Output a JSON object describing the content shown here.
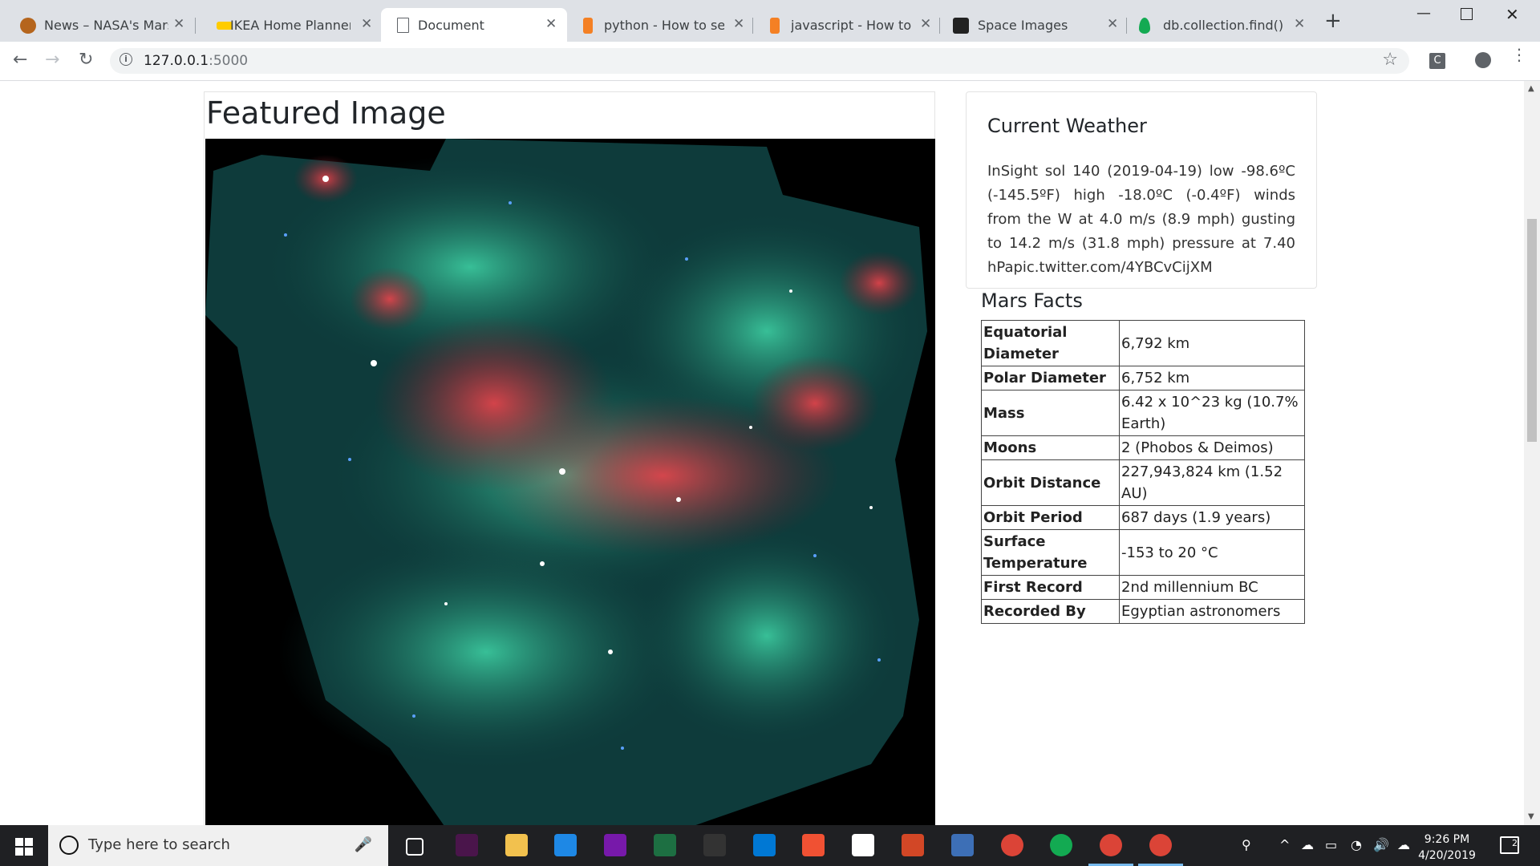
{
  "browser": {
    "tabs": [
      {
        "title": "News – NASA's Mars E",
        "color": "#b5651d",
        "active": false
      },
      {
        "title": "IKEA Home Planner",
        "color": "#ffcc00",
        "active": false
      },
      {
        "title": "Document",
        "color": "#ffffff",
        "active": true
      },
      {
        "title": "python - How to serve",
        "color": "#f48024",
        "active": false
      },
      {
        "title": "javascript - How to Cen",
        "color": "#f48024",
        "active": false
      },
      {
        "title": "Space Images",
        "color": "#222222",
        "active": false
      },
      {
        "title": "db.collection.find() — M",
        "color": "#13aa52",
        "active": false
      }
    ],
    "address": {
      "host": "127.0.0.1",
      "port": ":5000"
    },
    "extension_label": "C"
  },
  "page": {
    "featured_title": "Featured Image",
    "weather": {
      "title": "Current Weather",
      "text": "InSight sol 140 (2019-04-19) low -98.6ºC (-145.5ºF) high -18.0ºC (-0.4ºF) winds from the W at 4.0 m/s (8.9 mph) gusting to 14.2 m/s (31.8 mph) pressure at 7.40 hPapic.twitter.com/4YBCvCijXM"
    },
    "facts": {
      "title": "Mars Facts",
      "rows": [
        {
          "k": "Equatorial Diameter",
          "v": "6,792 km"
        },
        {
          "k": "Polar Diameter",
          "v": "6,752 km"
        },
        {
          "k": "Mass",
          "v": "6.42 x 10^23 kg (10.7% Earth)"
        },
        {
          "k": "Moons",
          "v": "2 (Phobos & Deimos)"
        },
        {
          "k": "Orbit Distance",
          "v": "227,943,824 km (1.52 AU)"
        },
        {
          "k": "Orbit Period",
          "v": "687 days (1.9 years)"
        },
        {
          "k": "Surface Temperature",
          "v": "-153 to 20 °C"
        },
        {
          "k": "First Record",
          "v": "2nd millennium BC"
        },
        {
          "k": "Recorded By",
          "v": "Egyptian astronomers"
        }
      ]
    }
  },
  "taskbar": {
    "search_placeholder": "Type here to search",
    "time": "9:26 PM",
    "date": "4/20/2019",
    "notification_count": "2",
    "apps": [
      {
        "name": "task-view-icon",
        "color": "#1f2023"
      },
      {
        "name": "slack-icon",
        "color": "#4a154b"
      },
      {
        "name": "file-explorer-icon",
        "color": "#f2c14e"
      },
      {
        "name": "security-icon",
        "color": "#1e88e5"
      },
      {
        "name": "onenote-icon",
        "color": "#7719aa"
      },
      {
        "name": "excel-icon",
        "color": "#1d6f42"
      },
      {
        "name": "terminal-icon",
        "color": "#333333"
      },
      {
        "name": "vscode-icon",
        "color": "#0078d4"
      },
      {
        "name": "git-icon",
        "color": "#f05133"
      },
      {
        "name": "onedrive-icon",
        "color": "#ffffff"
      },
      {
        "name": "powerpoint-icon",
        "color": "#d24726"
      },
      {
        "name": "mysql-workbench-icon",
        "color": "#3d6fb6"
      },
      {
        "name": "chrome-icon",
        "color": "#db4437"
      },
      {
        "name": "mongodb-icon",
        "color": "#13aa52"
      },
      {
        "name": "chrome-icon",
        "color": "#db4437"
      },
      {
        "name": "chrome-icon",
        "color": "#db4437"
      }
    ]
  }
}
